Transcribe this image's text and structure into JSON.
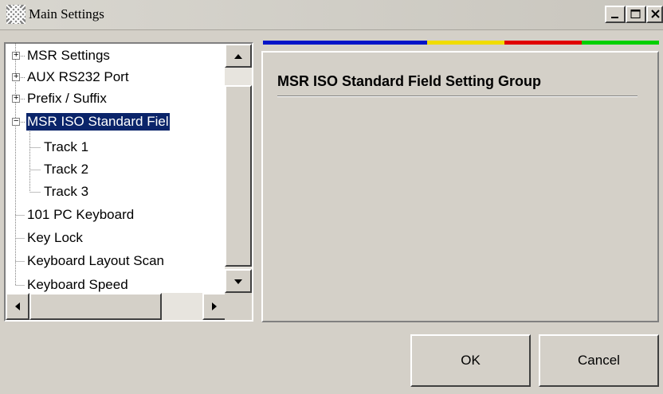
{
  "window": {
    "title": "Main Settings"
  },
  "tree": {
    "items": [
      {
        "label": "MSR Settings",
        "expander": "+"
      },
      {
        "label": "AUX RS232 Port",
        "expander": "+"
      },
      {
        "label": "Prefix / Suffix",
        "expander": "+"
      },
      {
        "label": "MSR ISO Standard Fiel",
        "expander": "−",
        "selected": true
      },
      {
        "label": "Track 1"
      },
      {
        "label": "Track 2"
      },
      {
        "label": "Track 3"
      },
      {
        "label": "101 PC Keyboard"
      },
      {
        "label": "Key Lock"
      },
      {
        "label": "Keyboard Layout Scan"
      },
      {
        "label": "Keyboard Speed"
      }
    ]
  },
  "colors": {
    "blue": "#0014c8",
    "yellow": "#f0dc00",
    "red": "#e00000",
    "green": "#00d000",
    "selection": "#0a246a"
  },
  "panel": {
    "group_title": "MSR ISO Standard Field Setting Group"
  },
  "buttons": {
    "ok": "OK",
    "cancel": "Cancel"
  }
}
